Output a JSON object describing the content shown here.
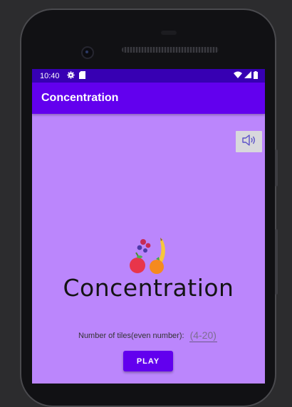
{
  "status_bar": {
    "time": "10:40"
  },
  "app_bar": {
    "title": "Concentration"
  },
  "main": {
    "game_title": "Concentration",
    "tiles_label": "Number of tiles(even number):",
    "tiles_placeholder": "(4-20)",
    "play_label": "PLAY"
  },
  "icons": {
    "sound": "speaker-volume-icon",
    "logo": "fruits-logo-icon"
  },
  "colors": {
    "status_bar": "#3700b3",
    "app_bar": "#6200ee",
    "background": "#bb86fc",
    "button": "#6200ee"
  }
}
